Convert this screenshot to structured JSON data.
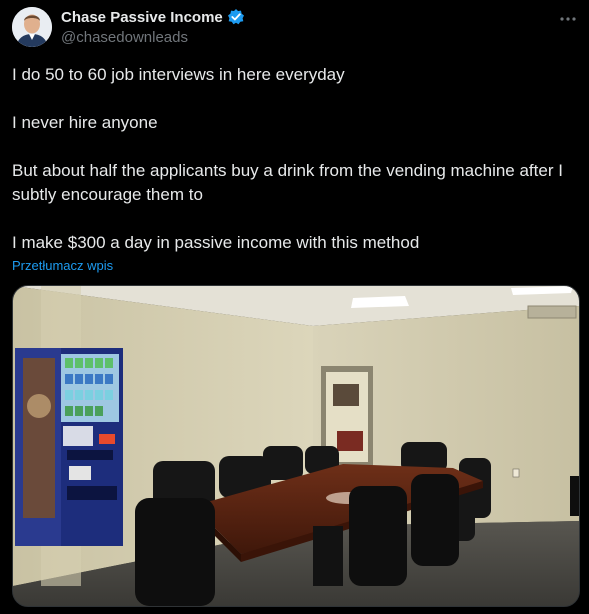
{
  "author": {
    "display_name": "Chase Passive Income",
    "handle": "@chasedownleads",
    "avatar_icon": "profile-photo",
    "verified_icon": "verified-badge-icon"
  },
  "menu": {
    "more_icon": "more-options-icon"
  },
  "post": {
    "paragraphs": [
      "I do 50 to 60 job interviews in here everyday",
      "I never hire anyone",
      "But about half the applicants buy a drink from the vending machine after I subtly encourage them to",
      "I make $300 a day in passive income with this method"
    ],
    "translate_label": "Przetłumacz wpis"
  },
  "media": {
    "scene": "conference-room-with-vending-machine"
  },
  "colors": {
    "background": "#000000",
    "text": "#e7e9ea",
    "muted": "#71767b",
    "link": "#1d9bf0",
    "verified": "#1d9bf0"
  }
}
